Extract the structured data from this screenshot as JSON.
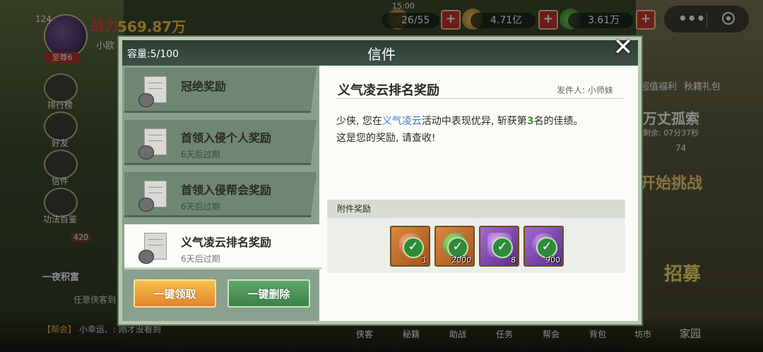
{
  "status": {
    "time": "15:00"
  },
  "player": {
    "level": "124",
    "power_label": "战力",
    "power": "569.87万",
    "name": "小欧",
    "rank": "至尊6"
  },
  "resources": [
    {
      "value": "26/55",
      "icon": "stamina-icon"
    },
    {
      "value": "4.71亿",
      "icon": "coin-icon"
    },
    {
      "value": "3.61万",
      "icon": "jade-icon"
    }
  ],
  "capsule": {
    "more": "•••"
  },
  "side_menu": [
    {
      "label": "排行榜",
      "icon": "ranking-icon"
    },
    {
      "label": "好友",
      "icon": "friends-icon"
    },
    {
      "label": "信件",
      "icon": "mail-icon"
    },
    {
      "label": "功法百鉴",
      "icon": "book-icon"
    }
  ],
  "left_misc": {
    "badge": "420",
    "event": "一夜积富",
    "task": "任意侠客到"
  },
  "right_panel": {
    "top_labels": [
      "超值福利",
      "秋籍礼包"
    ],
    "event_title": "万丈孤索",
    "event_timer": "剩余: 07分37秒",
    "event_cost": "74",
    "challenge": "开始挑战",
    "recruit": "招募"
  },
  "bottom": {
    "chat_tag": "【帮会】",
    "chat_text": "小幸运、: 刚才没看到",
    "tabs": [
      "侠客",
      "秘籍",
      "助战",
      "任务",
      "帮会",
      "背包",
      "坊市",
      "家园"
    ]
  },
  "mail": {
    "title": "信件",
    "capacity": "容量:5/100",
    "items": [
      {
        "name": "冠绝奖励",
        "expiry": ""
      },
      {
        "name": "首领入侵个人奖励",
        "expiry": "6天后过期"
      },
      {
        "name": "首领入侵帮会奖励",
        "expiry": "6天后过期"
      },
      {
        "name": "义气凌云排名奖励",
        "expiry": "6天后过期",
        "selected": true
      }
    ],
    "claim_all": "一键领取",
    "delete_all": "一键删除",
    "detail": {
      "title": "义气凌云排名奖励",
      "sender": "发件人: 小师妹",
      "body_p1": "少侠, 您在",
      "body_event": "义气凌云",
      "body_p2": "活动中表现优异, 斩获第",
      "body_rank": "3",
      "body_p3": "名的佳绩。",
      "body_line2": "这是您的奖励, 请查收!",
      "attachments_label": "附件奖励",
      "attachments": [
        {
          "qty": "1",
          "icon": "gift-bundle-icon",
          "frame": "orange"
        },
        {
          "qty": "2000",
          "icon": "jade-icon",
          "frame": "orange"
        },
        {
          "qty": "8",
          "icon": "crystal-icon",
          "frame": "purple"
        },
        {
          "qty": "900",
          "icon": "purple-orb-icon",
          "frame": "purple"
        }
      ]
    }
  },
  "colors": {
    "panel_bg": "#fbfcf7",
    "list_bg": "#8aa08e",
    "header_bg": "#2f3e35",
    "claim_btn": "#e3822a",
    "delete_btn": "#3c8048",
    "highlight_blue": "#3b7bd2",
    "highlight_green": "#3a9a3a"
  }
}
